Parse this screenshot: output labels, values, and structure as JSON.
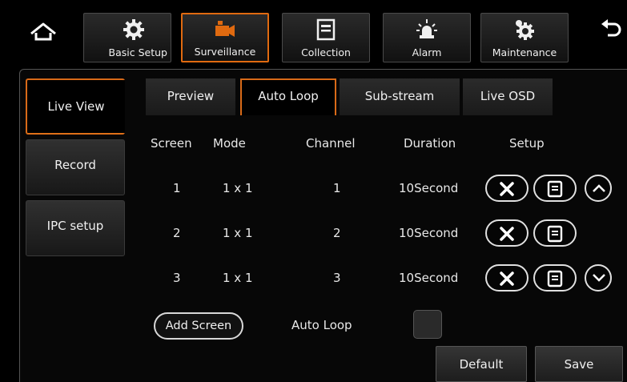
{
  "toolbar": {
    "home_icon": "home-icon",
    "back_icon": "back-arrow-icon",
    "tabs": [
      {
        "label": "Basic Setup",
        "icon": "gear-icon"
      },
      {
        "label": "Surveillance",
        "icon": "camera-icon"
      },
      {
        "label": "Collection",
        "icon": "document-icon"
      },
      {
        "label": "Alarm",
        "icon": "alarm-light-icon"
      },
      {
        "label": "Maintenance",
        "icon": "maintenance-gear-icon"
      }
    ],
    "active_tab": "Surveillance",
    "accent_color": "#e06a10"
  },
  "sidebar": {
    "items": [
      {
        "label": "Live View"
      },
      {
        "label": "Record"
      },
      {
        "label": "IPC setup"
      }
    ],
    "active": "Live View"
  },
  "subtabs": {
    "items": [
      {
        "label": "Preview"
      },
      {
        "label": "Auto Loop"
      },
      {
        "label": "Sub-stream"
      },
      {
        "label": "Live OSD"
      }
    ],
    "active": "Auto Loop"
  },
  "table": {
    "headers": [
      "Screen",
      "Mode",
      "Channel",
      "Duration",
      "Setup"
    ],
    "rows": [
      {
        "screen": "1",
        "mode": "1 x 1",
        "channel": "1",
        "duration": "10Second"
      },
      {
        "screen": "2",
        "mode": "1 x 1",
        "channel": "2",
        "duration": "10Second"
      },
      {
        "screen": "3",
        "mode": "1 x 1",
        "channel": "3",
        "duration": "10Second"
      }
    ]
  },
  "controls": {
    "add_screen": "Add Screen",
    "auto_loop_label": "Auto Loop",
    "auto_loop_checked": false,
    "default_button": "Default",
    "save_button": "Save"
  }
}
